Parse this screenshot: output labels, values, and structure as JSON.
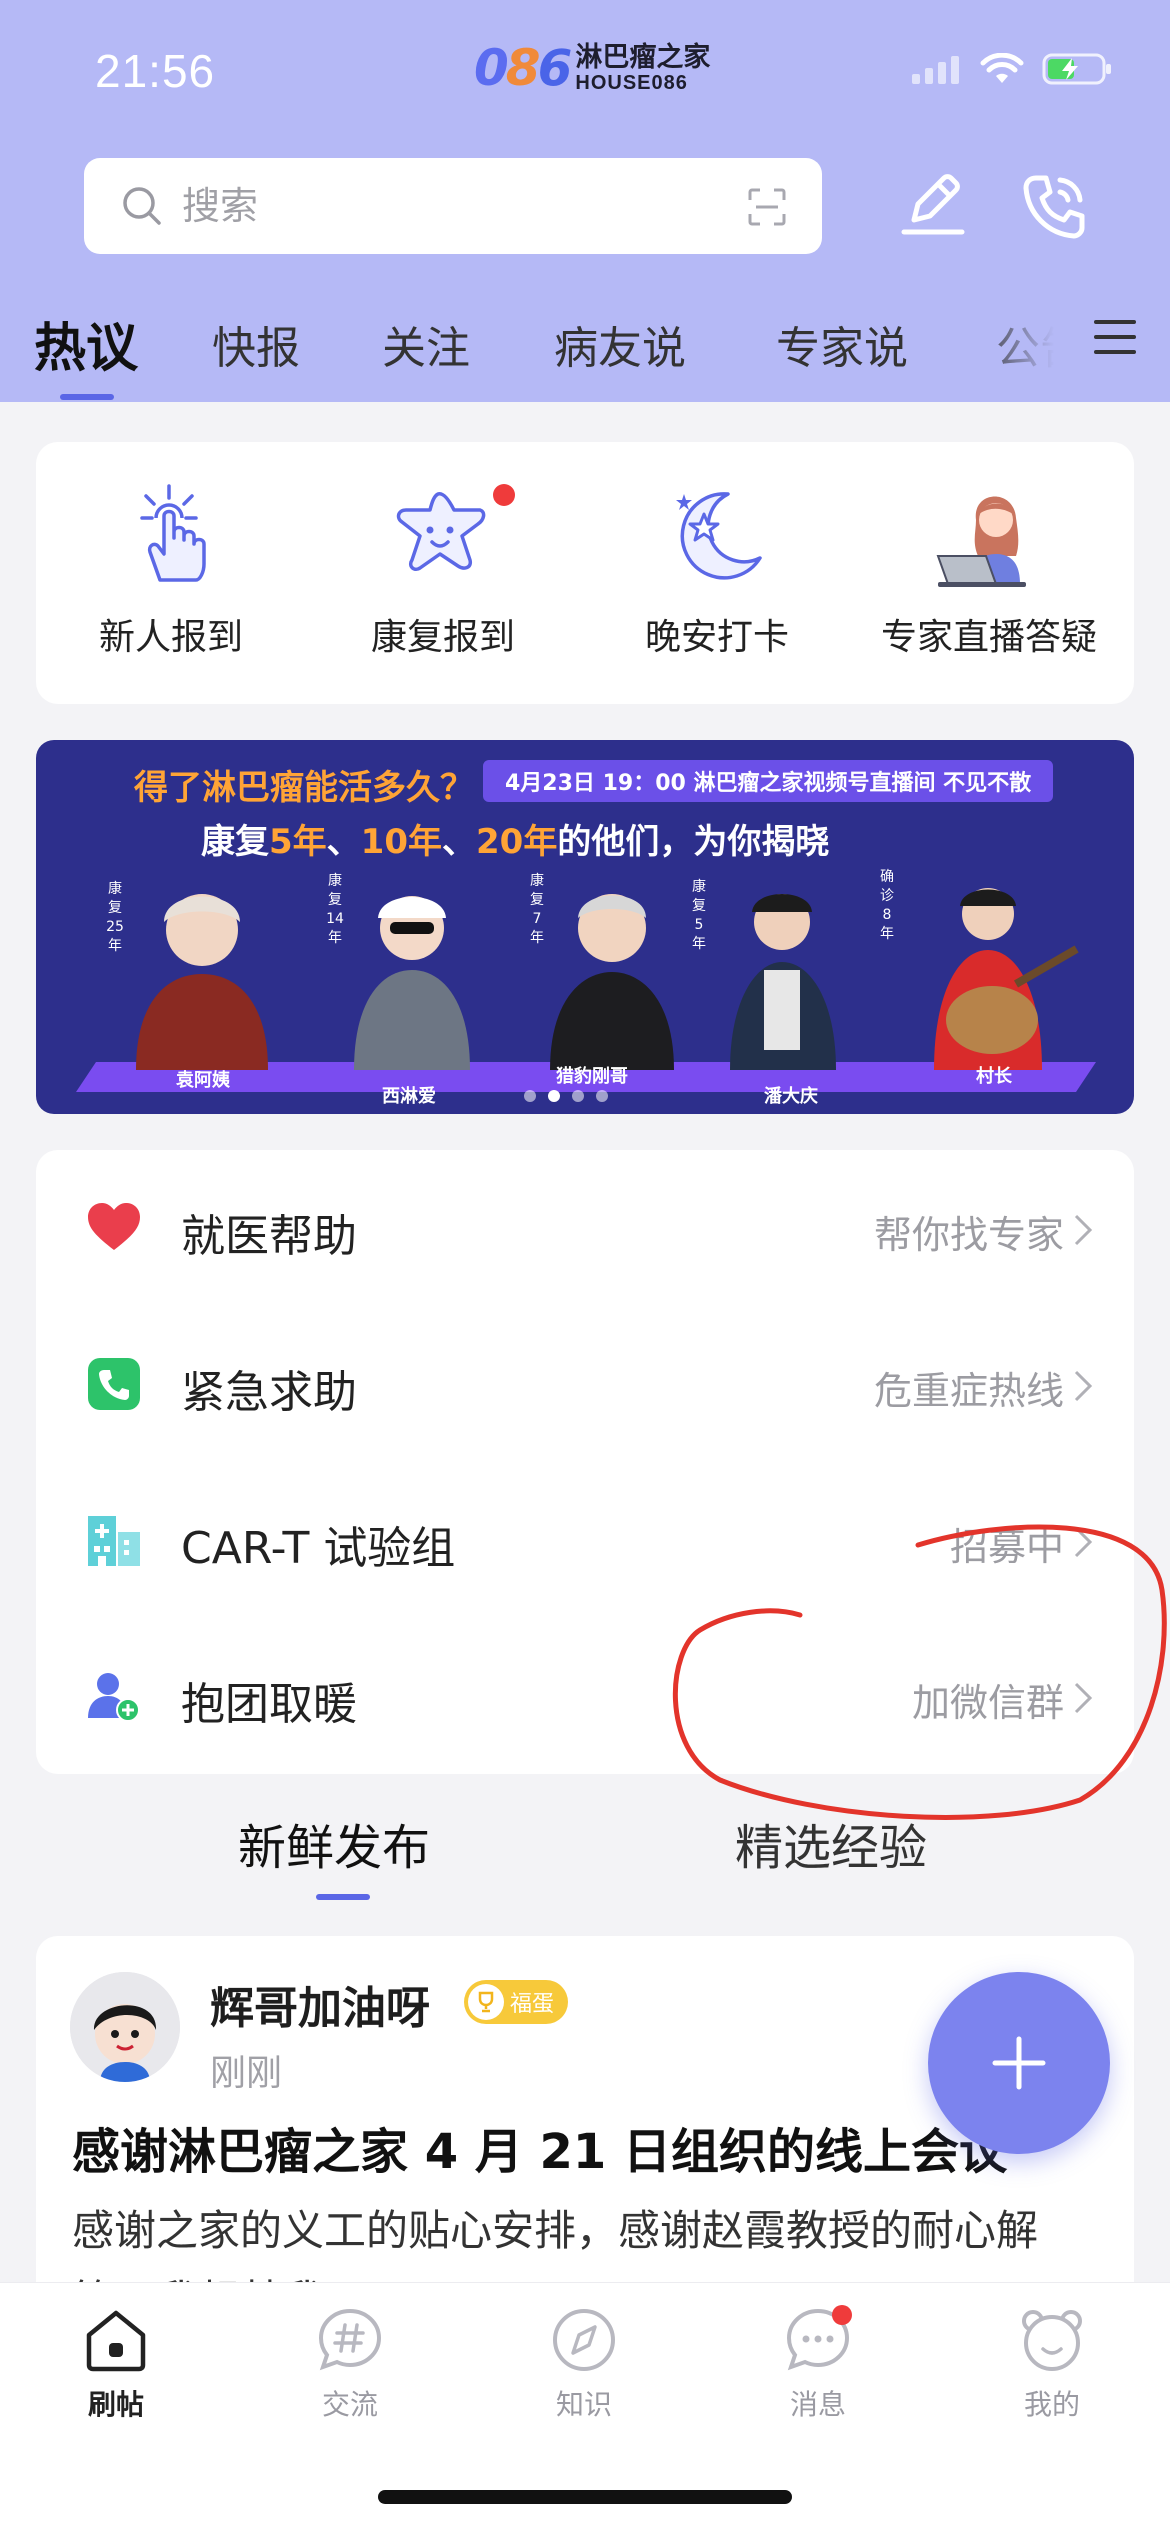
{
  "status_bar": {
    "time": "21:56"
  },
  "brand": {
    "mark": "086",
    "name_cn": "淋巴瘤之家",
    "name_en": "HOUSE086"
  },
  "search": {
    "placeholder": "搜索"
  },
  "top_tabs": [
    "热议",
    "快报",
    "关注",
    "病友说",
    "专家说",
    "公告"
  ],
  "active_top_tab": "热议",
  "quick_actions": [
    {
      "label": "新人报到",
      "icon": "tap-hand-icon"
    },
    {
      "label": "康复报到",
      "icon": "star-face-icon",
      "dot": true
    },
    {
      "label": "晚安打卡",
      "icon": "moon-star-icon"
    },
    {
      "label": "专家直播答疑",
      "icon": "expert-laptop-icon"
    }
  ],
  "banner": {
    "question": "得了淋巴瘤能活多久？",
    "schedule": "4月23日 19：00 淋巴瘤之家视频号直播间 不见不散",
    "headline_parts": [
      "康复",
      "5年",
      "、",
      "10年",
      "、",
      "20年",
      "的他们，为你揭晓"
    ],
    "people": [
      {
        "name": "袁阿姨",
        "years": "康复25年"
      },
      {
        "name": "西淋爱",
        "years": "康复14年"
      },
      {
        "name": "猎豹刚哥",
        "years": "康复7年"
      },
      {
        "name": "潘大庆",
        "years": "康复5年"
      },
      {
        "name": "村长",
        "years": "确诊8年"
      }
    ],
    "slide_count": 4,
    "active_slide": 1
  },
  "services": [
    {
      "title": "就医帮助",
      "sub": "帮你找专家",
      "icon": "heart-icon",
      "color": "#ea3e4c"
    },
    {
      "title": "紧急求助",
      "sub": "危重症热线",
      "icon": "phone-icon",
      "color": "#2dc36a"
    },
    {
      "title": "CAR-T 试验组",
      "sub": "招募中",
      "icon": "hospital-icon",
      "color": "#5ed0d8"
    },
    {
      "title": "抱团取暖",
      "sub": "加微信群",
      "icon": "group-add-icon",
      "color": "#5b72ea"
    }
  ],
  "feed_tabs": [
    "新鲜发布",
    "精选经验"
  ],
  "active_feed_tab": "新鲜发布",
  "post": {
    "author": "辉哥加油呀",
    "badge": "福蛋",
    "time": "刚刚",
    "title": "感谢淋巴瘤之家 4 月 21 日组织的线上会议",
    "body": "感谢之家的义工的贴心安排，感谢赵霞教授的耐心解答，我想替我..."
  },
  "bottom_nav": [
    {
      "label": "刷帖",
      "icon": "home-icon",
      "active": true
    },
    {
      "label": "交流",
      "icon": "hashtag-bubble-icon"
    },
    {
      "label": "知识",
      "icon": "compass-icon"
    },
    {
      "label": "消息",
      "icon": "chat-bubble-icon",
      "dot": true
    },
    {
      "label": "我的",
      "icon": "bear-face-icon"
    }
  ],
  "colors": {
    "header_bg": "#b5b9f6",
    "accent": "#5a66e6",
    "fab": "#7c83ee",
    "annotation": "#e3342b",
    "banner_bg": "#2d2f8c",
    "banner_highlight": "#ffa436"
  }
}
